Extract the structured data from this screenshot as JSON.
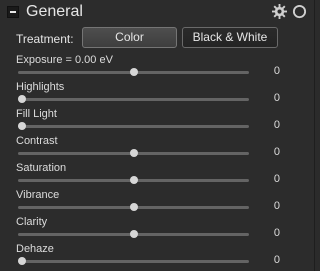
{
  "header": {
    "title": "General",
    "settings_icon": "gear-icon",
    "toggle_icon": "circle-icon"
  },
  "treatment": {
    "label": "Treatment:",
    "options": [
      "Color",
      "Black & White"
    ],
    "selected": "Color"
  },
  "sliders": [
    {
      "label": "Exposure = 0.00 eV",
      "value": "0",
      "position": 0.5
    },
    {
      "label": "Highlights",
      "value": "0",
      "position": 0.0
    },
    {
      "label": "Fill Light",
      "value": "0",
      "position": 0.0
    },
    {
      "label": "Contrast",
      "value": "0",
      "position": 0.5
    },
    {
      "label": "Saturation",
      "value": "0",
      "position": 0.5
    },
    {
      "label": "Vibrance",
      "value": "0",
      "position": 0.5
    },
    {
      "label": "Clarity",
      "value": "0",
      "position": 0.5
    },
    {
      "label": "Dehaze",
      "value": "0",
      "position": 0.0
    }
  ]
}
